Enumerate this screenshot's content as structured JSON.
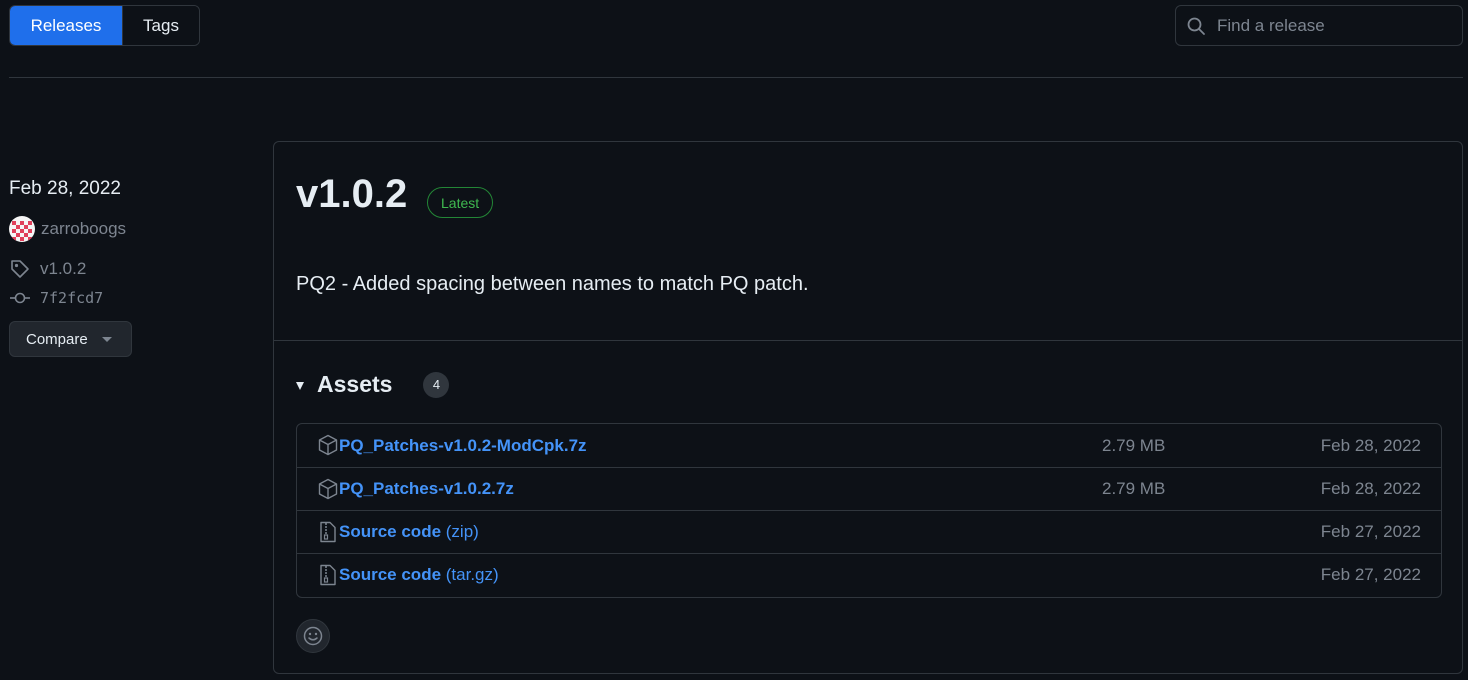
{
  "tabs": {
    "releases_label": "Releases",
    "tags_label": "Tags"
  },
  "search": {
    "placeholder": "Find a release"
  },
  "release_meta": {
    "date": "Feb 28, 2022",
    "author": "zarroboogs",
    "tag": "v1.0.2",
    "commit": "7f2fcd7",
    "compare_label": "Compare"
  },
  "release": {
    "title": "v1.0.2",
    "badge": "Latest",
    "body": "PQ2 - Added spacing between names to match PQ patch.",
    "assets_label": "Assets",
    "assets_count": "4",
    "assets": [
      {
        "icon": "package-icon",
        "name": "PQ_Patches-v1.0.2-ModCpk.7z",
        "suffix": "",
        "size": "2.79 MB",
        "date": "Feb 28, 2022"
      },
      {
        "icon": "package-icon",
        "name": "PQ_Patches-v1.0.2.7z",
        "suffix": "",
        "size": "2.79 MB",
        "date": "Feb 28, 2022"
      },
      {
        "icon": "file-zip-icon",
        "name": "Source code",
        "suffix": " (zip)",
        "size": "",
        "date": "Feb 27, 2022"
      },
      {
        "icon": "file-zip-icon",
        "name": "Source code",
        "suffix": " (tar.gz)",
        "size": "",
        "date": "Feb 27, 2022"
      }
    ]
  },
  "colors": {
    "background": "#0d1117",
    "accent": "#1f6feb",
    "link": "#4493f8",
    "latest_green": "#3fb950",
    "border": "#30363d"
  }
}
